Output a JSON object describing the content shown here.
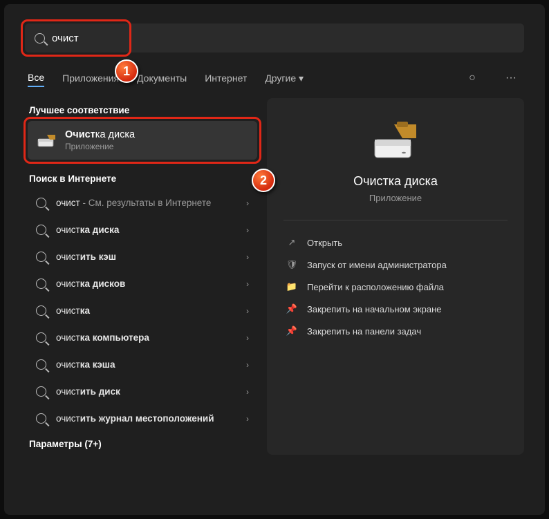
{
  "search": {
    "query": "очист"
  },
  "tabs": {
    "items": [
      "Все",
      "Приложения",
      "Документы",
      "Интернет",
      "Другие"
    ],
    "dropdown_glyph": "▾",
    "more_glyph": "···",
    "circle_glyph": "○"
  },
  "left": {
    "best_match_label": "Лучшее соответствие",
    "best": {
      "title_pre": "Очист",
      "title_post": "ка диска",
      "subtitle": "Приложение"
    },
    "web_label": "Поиск в Интернете",
    "results": [
      {
        "pre": "очист",
        "post": "",
        "tail": " - См. результаты в Интернете"
      },
      {
        "pre": "очист",
        "post": "ка диска",
        "tail": ""
      },
      {
        "pre": "очист",
        "post": "ить кэш",
        "tail": ""
      },
      {
        "pre": "очист",
        "post": "ка дисков",
        "tail": ""
      },
      {
        "pre": "очист",
        "post": "ка",
        "tail": ""
      },
      {
        "pre": "очист",
        "post": "ка компьютера",
        "tail": ""
      },
      {
        "pre": "очист",
        "post": "ка кэша",
        "tail": ""
      },
      {
        "pre": "очист",
        "post": "ить диск",
        "tail": ""
      },
      {
        "pre": "очист",
        "post": "ить журнал местоположений",
        "tail": ""
      }
    ],
    "params_label": "Параметры (7+)",
    "chevron": "›"
  },
  "detail": {
    "title": "Очистка диска",
    "subtitle": "Приложение",
    "actions": [
      {
        "icon": "↗",
        "label": "Открыть"
      },
      {
        "icon": "🛡",
        "label": "Запуск от имени администратора"
      },
      {
        "icon": "📁",
        "label": "Перейти к расположению файла"
      },
      {
        "icon": "📌",
        "label": "Закрепить на начальном экране"
      },
      {
        "icon": "📌",
        "label": "Закрепить на панели задач"
      }
    ]
  },
  "markers": {
    "m1": "1",
    "m2": "2"
  }
}
